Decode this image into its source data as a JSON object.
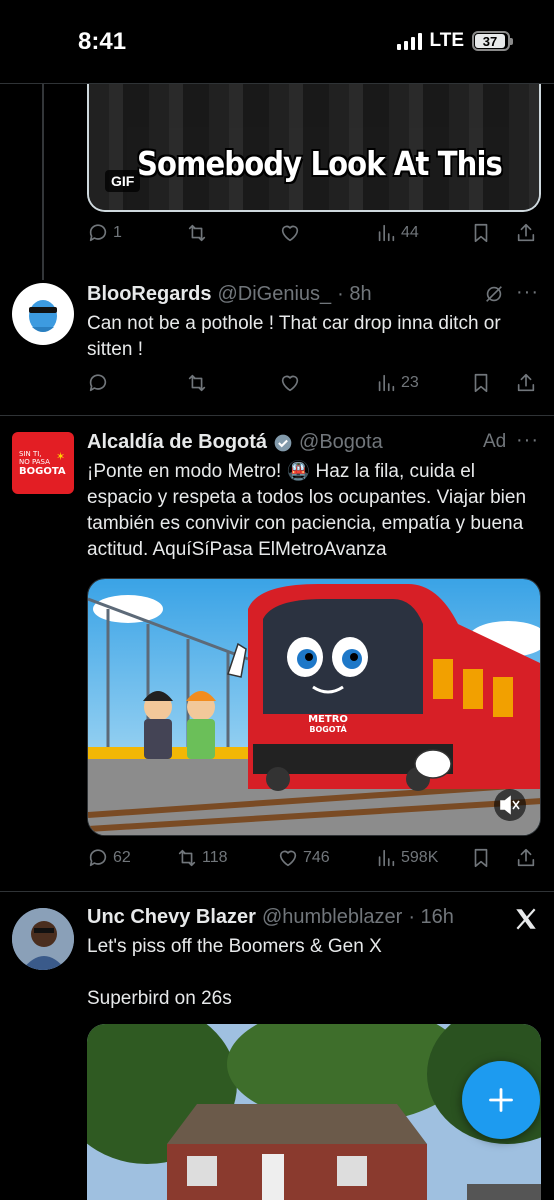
{
  "status_bar": {
    "time": "8:41",
    "network": "LTE",
    "battery": "37"
  },
  "gif_post": {
    "caption": "Somebody Look At This",
    "badge": "GIF",
    "replies": "1",
    "views": "44"
  },
  "reply_post": {
    "name": "BlooRegards",
    "handle": "@DiGenius_",
    "time": "· 8h",
    "text": "Can not be a pothole ! That car drop inna ditch or sitten !",
    "views": "23"
  },
  "ad_post": {
    "name": "Alcaldía de Bogotá",
    "handle": "@Bogota",
    "ad_label": "Ad",
    "avatar_line1": "SIN TI,",
    "avatar_line2": "NO PASA",
    "avatar_line3": "BOGOTA",
    "text": "¡Ponte en modo Metro! 🚇 Haz la fila, cuida el espacio y respeta a todos los ocupantes. Viajar bien también es convivir con paciencia, empatía y buena actitud. AquíSíPasa ElMetroAvanza",
    "train_label_1": "METRO",
    "train_label_2": "BOGOTÁ",
    "replies": "62",
    "reposts": "118",
    "likes": "746",
    "views": "598K"
  },
  "next_post": {
    "name": "Unc Chevy Blazer",
    "handle": "@humbleblazer",
    "time": "· 16h",
    "line1": "Let's piss off the Boomers & Gen X",
    "line2": "Superbird on 26s"
  },
  "colors": {
    "accent": "#1d9bf0",
    "background": "#000000",
    "secondary_text": "#71767b"
  }
}
